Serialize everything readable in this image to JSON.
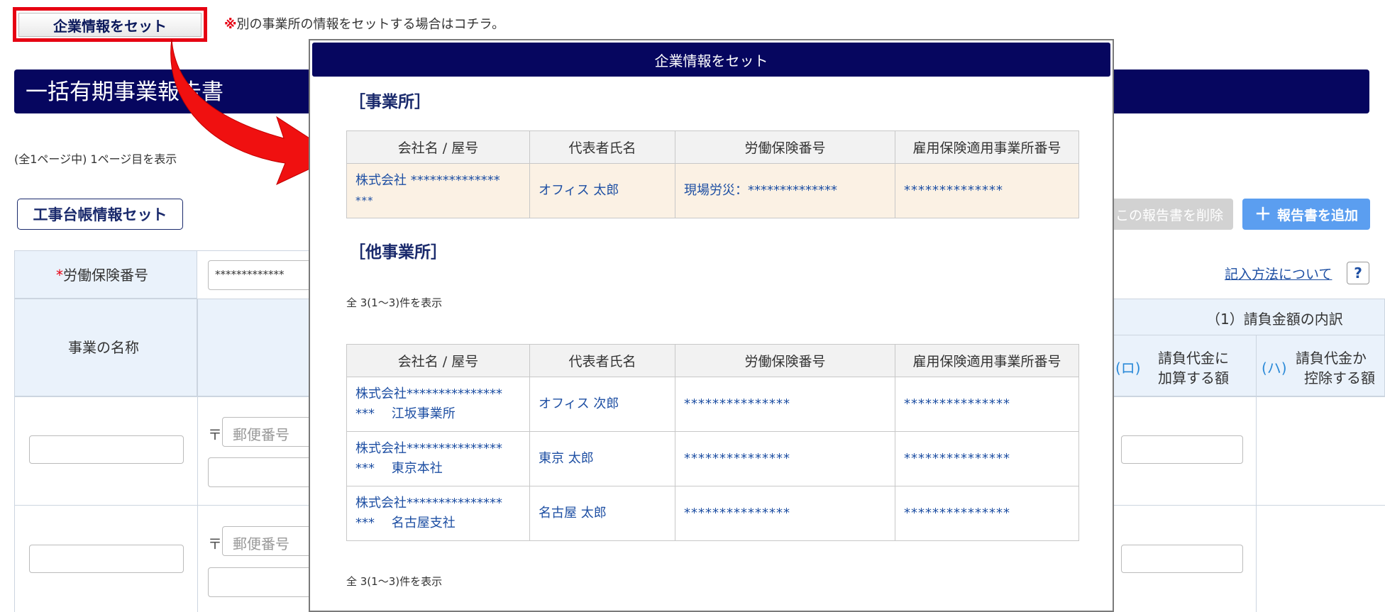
{
  "top": {
    "set_button": "企業情報をセット",
    "note_mark": "※",
    "note_text": "別の事業所の情報をセットする場合はコチラ。"
  },
  "title": "一括有期事業報告書",
  "page_info": "(全1ページ中) 1ページ目を表示",
  "ledger_button": "工事台帳情報セット",
  "delete_button": "この報告書を削除",
  "add_button": "報告書を追加",
  "help_link": "記入方法について",
  "help_icon": "?",
  "form": {
    "required_mark": "*",
    "labor_label": "労働保険番号",
    "labor_value": "*************",
    "business_name_label": "事業の名称",
    "breakdown_label": "（1）請負金額の内訳",
    "col_ro_mark": "(ロ)",
    "col_ro_line1": "請負代金に",
    "col_ro_line2": "加算する額",
    "col_ha_mark": "(ハ)",
    "col_ha_line1": "請負代金か",
    "col_ha_line2": "控除する額",
    "postal_mark": "〒",
    "postal_placeholder": "郵便番号"
  },
  "modal": {
    "header": "企業情報をセット",
    "office_title": "［事業所］",
    "other_title": "［他事業所］",
    "columns": [
      "会社名 / 屋号",
      "代表者氏名",
      "労働保険番号",
      "雇用保険適用事業所番号"
    ],
    "office_row": {
      "company_line1": "株式会社 **************",
      "company_line2": "***",
      "rep": "オフィス 太郎",
      "labor": "現場労災：**************",
      "employment": "**************"
    },
    "count_top": "全 3(1〜3)件を表示",
    "count_bottom": "全 3(1〜3)件を表示",
    "other_rows": [
      {
        "company_line1": "株式会社***************",
        "company_line2": "***　 江坂事業所",
        "rep": "オフィス 次郎",
        "labor": "***************",
        "employment": "***************"
      },
      {
        "company_line1": "株式会社***************",
        "company_line2": "***　 東京本社",
        "rep": "東京 太郎",
        "labor": "***************",
        "employment": "***************"
      },
      {
        "company_line1": "株式会社***************",
        "company_line2": "***　 名古屋支社",
        "rep": "名古屋 太郎",
        "labor": "***************",
        "employment": "***************"
      }
    ]
  },
  "colors": {
    "navy": "#06065f",
    "highlight_red": "#e60012",
    "link_blue": "#1e4fa3",
    "add_blue": "#5b9ef0",
    "row_highlight": "#fbf1e4"
  }
}
